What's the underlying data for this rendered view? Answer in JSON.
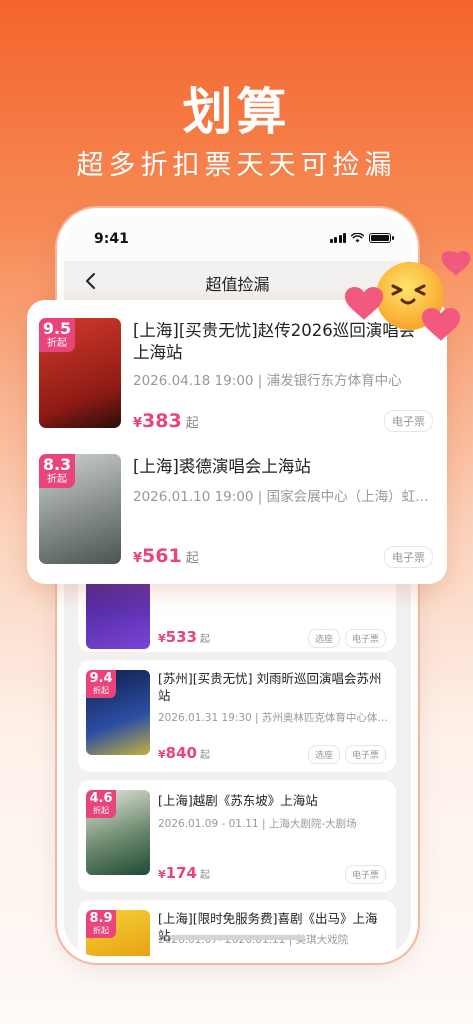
{
  "hero": {
    "title": "划算",
    "subtitle": "超多折扣票天天可捡漏"
  },
  "status": {
    "time": "9:41"
  },
  "nav": {
    "title": "超值捡漏",
    "back_icon": "chevron-left-icon"
  },
  "popup_items": [
    {
      "discount": "9.5",
      "discount_unit": "折起",
      "title": "[上海][买贵无忧]赵传2026巡回演唱会上海站",
      "meta": "2026.04.18 19:00 | 浦发银行东方体育中心",
      "currency": "¥",
      "price": "383",
      "price_suffix": "起",
      "tags": [
        "电子票"
      ],
      "poster_color": "#b0231c"
    },
    {
      "discount": "8.3",
      "discount_unit": "折起",
      "title": "[上海]裘德演唱会上海站",
      "meta": "2026.01.10 19:00 | 国家会展中心（上海）虹…",
      "currency": "¥",
      "price": "561",
      "price_suffix": "起",
      "tags": [
        "电子票"
      ],
      "poster_color": "#6f7a73"
    }
  ],
  "list_items": [
    {
      "currency": "¥",
      "price": "533",
      "price_suffix": "起",
      "tags": [
        "选座",
        "电子票"
      ],
      "poster_color": "#5a2aa8"
    },
    {
      "discount": "9.4",
      "discount_unit": "折起",
      "title": "[苏州][买贵无忧] 刘雨昕巡回演唱会苏州站",
      "meta": "2026.01.31 19:30 | 苏州奥林匹克体育中心体…",
      "currency": "¥",
      "price": "840",
      "price_suffix": "起",
      "tags": [
        "选座",
        "电子票"
      ],
      "poster_color": "#1c2f6b"
    },
    {
      "discount": "4.6",
      "discount_unit": "折起",
      "title": "[上海]越剧《苏东坡》上海站",
      "meta": "2026.01.09 - 01.11 | 上海大剧院-大剧场",
      "currency": "¥",
      "price": "174",
      "price_suffix": "起",
      "tags": [
        "电子票"
      ],
      "poster_color": "#2e5a43"
    },
    {
      "discount": "8.9",
      "discount_unit": "折起",
      "title": "[上海][限时免服务费]喜剧《出马》上海站",
      "meta": "2026.01.07- 2026.01.11 | 美琪大戏院",
      "currency": "¥",
      "price": "",
      "price_suffix": "",
      "tags": [],
      "poster_color": "#e9b616"
    }
  ],
  "colors": {
    "accent": "#e9457a",
    "brand_orange": "#f3642c"
  }
}
